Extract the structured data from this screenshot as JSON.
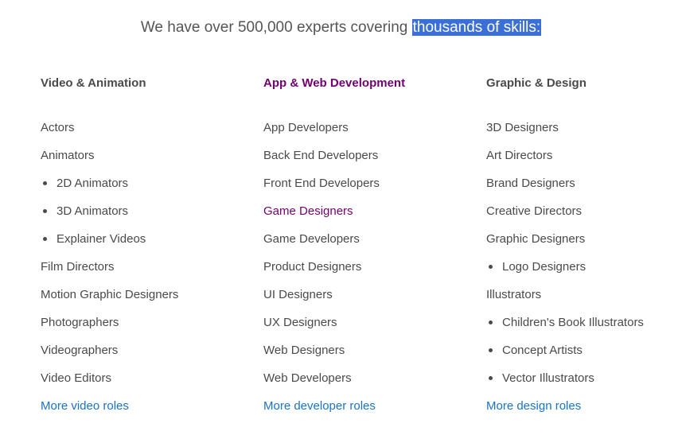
{
  "headline": {
    "prefix": "We have over 500,000 experts covering ",
    "highlight": "thousands of skills:"
  },
  "colors": {
    "text": "#4a4a4a",
    "active": "#720072",
    "link": "#1a73c4",
    "highlight_bg": "#3a6fd8"
  },
  "columns": [
    {
      "title": "Video & Animation",
      "items": [
        {
          "label": "Actors",
          "level": 0
        },
        {
          "label": "Animators",
          "level": 0
        },
        {
          "label": "2D Animators",
          "level": 1
        },
        {
          "label": "3D Animators",
          "level": 1
        },
        {
          "label": "Explainer Videos",
          "level": 1
        },
        {
          "label": "Film Directors",
          "level": 0
        },
        {
          "label": "Motion Graphic Designers",
          "level": 0
        },
        {
          "label": "Photographers",
          "level": 0
        },
        {
          "label": "Videographers",
          "level": 0
        },
        {
          "label": "Video Editors",
          "level": 0
        }
      ],
      "more": "More video roles"
    },
    {
      "title": "App & Web Development",
      "title_active": true,
      "items": [
        {
          "label": "App Developers",
          "level": 0
        },
        {
          "label": "Back End Developers",
          "level": 0
        },
        {
          "label": "Front End Developers",
          "level": 0
        },
        {
          "label": "Game Designers",
          "level": 0,
          "active": true
        },
        {
          "label": "Game Developers",
          "level": 0
        },
        {
          "label": "Product Designers",
          "level": 0
        },
        {
          "label": "UI Designers",
          "level": 0
        },
        {
          "label": "UX Designers",
          "level": 0
        },
        {
          "label": "Web Designers",
          "level": 0
        },
        {
          "label": "Web Developers",
          "level": 0
        }
      ],
      "more": "More developer roles"
    },
    {
      "title": "Graphic & Design",
      "items": [
        {
          "label": "3D Designers",
          "level": 0
        },
        {
          "label": "Art Directors",
          "level": 0
        },
        {
          "label": "Brand Designers",
          "level": 0
        },
        {
          "label": "Creative Directors",
          "level": 0
        },
        {
          "label": "Graphic Designers",
          "level": 0
        },
        {
          "label": "Logo Designers",
          "level": 1
        },
        {
          "label": "Illustrators",
          "level": 0
        },
        {
          "label": "Children's Book Illustrators",
          "level": 1
        },
        {
          "label": "Concept Artists",
          "level": 1
        },
        {
          "label": "Vector Illustrators",
          "level": 1
        }
      ],
      "more": "More design roles"
    }
  ]
}
